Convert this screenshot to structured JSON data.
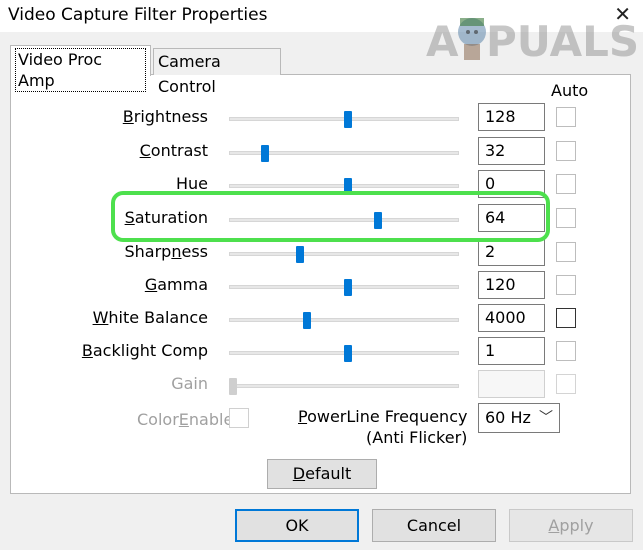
{
  "window": {
    "title": "Video Capture Filter Properties",
    "close_glyph": "✕"
  },
  "watermark": {
    "text_a": "A",
    "text_rest": "PUALS"
  },
  "tabs": [
    {
      "label": "Video Proc Amp",
      "active": true
    },
    {
      "label": "Camera Control",
      "active": false
    }
  ],
  "auto_header": "Auto",
  "rows": [
    {
      "label_u": "B",
      "label_rest": "rightness",
      "value": "128",
      "position": 0.5
    },
    {
      "label_pre": "",
      "label_u": "C",
      "label_rest": "ontrast",
      "value": "32",
      "position": 0.14
    },
    {
      "label": "Hue",
      "value": "0",
      "position": 0.5
    },
    {
      "label_u": "S",
      "label_rest": "aturation",
      "value": "64",
      "position": 0.63
    },
    {
      "label_pre": "Sharp",
      "label_u": "n",
      "label_rest": "ess",
      "value": "2",
      "position": 0.29
    },
    {
      "label_u": "G",
      "label_rest": "amma",
      "value": "120",
      "position": 0.5
    },
    {
      "label_u": "W",
      "label_rest": "hite Balance",
      "value": "4000",
      "position": 0.32
    },
    {
      "label_u": "B",
      "label_rest": "acklight Comp",
      "value": "1",
      "position": 0.5
    },
    {
      "label": "Gain",
      "value": "",
      "position": 0.0
    }
  ],
  "color_enable": {
    "label_pre": "Color",
    "label_u": "E",
    "label_rest": "nable"
  },
  "powerline": {
    "label_u": "P",
    "label_rest": "owerLine Frequency",
    "label_line2": "(Anti Flicker)",
    "selected": "60 Hz",
    "chevron": "﹀"
  },
  "buttons": {
    "default_u": "D",
    "default_rest": "efault",
    "ok": "OK",
    "cancel": "Cancel",
    "apply_u": "A",
    "apply_rest": "pply"
  },
  "colors": {
    "accent": "#0078d7",
    "highlight": "#4de04d"
  }
}
